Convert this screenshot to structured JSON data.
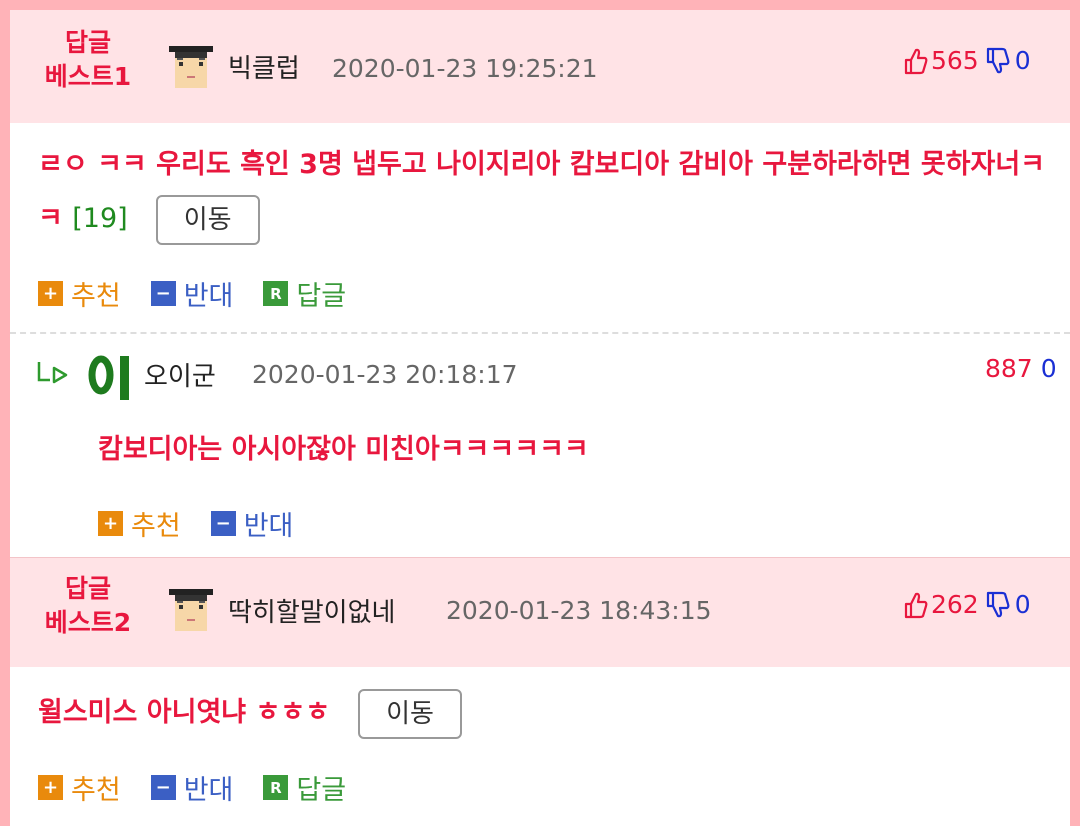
{
  "post1": {
    "label_line1": "답글",
    "label_line2": "베스트1",
    "nickname": "빅클럽",
    "date": "2020-01-23 19:25:21",
    "up": "565",
    "down": "0",
    "content": "ㄹㅇ ㅋㅋ 우리도 흑인 3명 냅두고 나이지리아 캄보디아 감비아 구분하라하면 못하자너ㅋㅋ",
    "reply_count": "[19]",
    "move_label": "이동",
    "actions": {
      "recommend": "추천",
      "oppose": "반대",
      "reply": "답글"
    }
  },
  "reply": {
    "nickname": "오이군",
    "date": "2020-01-23 20:18:17",
    "up": "887",
    "down": "0",
    "content": "캄보디아는 아시아잖아 미친아ㅋㅋㅋㅋㅋㅋ",
    "actions": {
      "recommend": "추천",
      "oppose": "반대"
    }
  },
  "post2": {
    "label_line1": "답글",
    "label_line2": "베스트2",
    "nickname": "딱히할말이없네",
    "date": "2020-01-23 18:43:15",
    "up": "262",
    "down": "0",
    "content": "윌스미스 아니엿냐 ㅎㅎㅎ",
    "move_label": "이동",
    "actions": {
      "recommend": "추천",
      "oppose": "반대",
      "reply": "답글"
    }
  },
  "icons": {
    "avatar": "grad-cap-avatar-icon",
    "thumb_up": "thumb-up-icon",
    "thumb_down": "thumb-down-icon",
    "reply_arrow": "reply-arrow-icon",
    "level_badge": "level-badge-icon"
  },
  "colors": {
    "accent_red": "#e8173e",
    "header_bg": "#ffe3e6",
    "frame_pink": "#ffb3b8",
    "recommend_orange": "#e98a0c",
    "oppose_blue": "#3b5fc4",
    "reply_green": "#3a9a3a",
    "vote_down_blue": "#1a2fd4"
  }
}
